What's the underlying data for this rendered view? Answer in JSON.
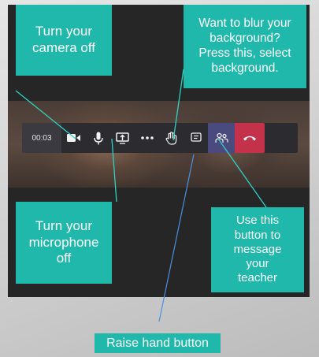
{
  "toolbar": {
    "timer": "00:03",
    "buttons": [
      {
        "name": "camera",
        "icon": "camera-icon"
      },
      {
        "name": "microphone",
        "icon": "microphone-icon"
      },
      {
        "name": "share",
        "icon": "share-screen-icon"
      },
      {
        "name": "more",
        "icon": "more-options-icon"
      },
      {
        "name": "raise-hand",
        "icon": "hand-icon"
      },
      {
        "name": "chat",
        "icon": "chat-icon"
      },
      {
        "name": "participants",
        "icon": "people-icon"
      },
      {
        "name": "hang-up",
        "icon": "phone-hangup-icon"
      }
    ]
  },
  "callouts": {
    "camera": "Turn your\ncamera off",
    "blur": "Want to blur your\nbackground?\nPress this, select\nbackground.",
    "mic": "Turn your\nmicrophone\noff",
    "chat": "Use this\nbutton to\nmessage\nyour\nteacher",
    "raise_hand": "Raise hand button"
  },
  "colors": {
    "callout": "#1fb8aa",
    "toolbar": "#2b2b30",
    "participants": "#4b4a7e",
    "hangup": "#c4314b",
    "pointer": "#4a90e2"
  }
}
